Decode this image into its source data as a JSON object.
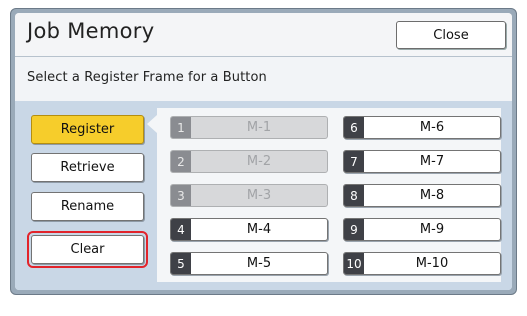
{
  "header": {
    "title": "Job Memory",
    "close_label": "Close"
  },
  "instruction": "Select a Register Frame for a Button",
  "modes": [
    {
      "label": "Register",
      "active": true
    },
    {
      "label": "Retrieve",
      "active": false
    },
    {
      "label": "Rename",
      "active": false
    },
    {
      "label": "Clear",
      "active": false,
      "highlighted": true
    }
  ],
  "frames": [
    {
      "num": "1",
      "name": "M-1",
      "enabled": false
    },
    {
      "num": "2",
      "name": "M-2",
      "enabled": false
    },
    {
      "num": "3",
      "name": "M-3",
      "enabled": false
    },
    {
      "num": "4",
      "name": "M-4",
      "enabled": true
    },
    {
      "num": "5",
      "name": "M-5",
      "enabled": true
    },
    {
      "num": "6",
      "name": "M-6",
      "enabled": true
    },
    {
      "num": "7",
      "name": "M-7",
      "enabled": true
    },
    {
      "num": "8",
      "name": "M-8",
      "enabled": true
    },
    {
      "num": "9",
      "name": "M-9",
      "enabled": true
    },
    {
      "num": "10",
      "name": "M-10",
      "enabled": true
    }
  ],
  "colors": {
    "active_button": "#f6cd2b",
    "highlight_outline": "#e2242b",
    "content_background": "#c9d7e6",
    "number_tab": "#3f4147"
  }
}
